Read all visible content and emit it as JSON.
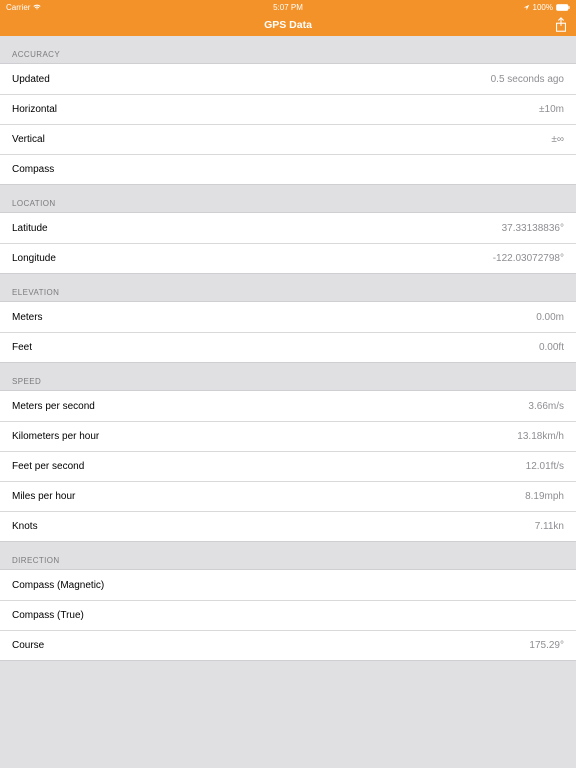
{
  "status": {
    "carrier": "Carrier",
    "time": "5:07 PM",
    "battery": "100%"
  },
  "nav": {
    "title": "GPS Data"
  },
  "sections": {
    "accuracy": {
      "header": "ACCURACY",
      "rows": {
        "updated": {
          "label": "Updated",
          "value": "0.5 seconds ago"
        },
        "horizontal": {
          "label": "Horizontal",
          "value": "±10m"
        },
        "vertical": {
          "label": "Vertical",
          "value": "±∞"
        },
        "compass": {
          "label": "Compass",
          "value": ""
        }
      }
    },
    "location": {
      "header": "LOCATION",
      "rows": {
        "latitude": {
          "label": "Latitude",
          "value": "37.33138836°"
        },
        "longitude": {
          "label": "Longitude",
          "value": "-122.03072798°"
        }
      }
    },
    "elevation": {
      "header": "ELEVATION",
      "rows": {
        "meters": {
          "label": "Meters",
          "value": "0.00m"
        },
        "feet": {
          "label": "Feet",
          "value": "0.00ft"
        }
      }
    },
    "speed": {
      "header": "SPEED",
      "rows": {
        "mps": {
          "label": "Meters per second",
          "value": "3.66m/s"
        },
        "kmh": {
          "label": "Kilometers per hour",
          "value": "13.18km/h"
        },
        "fps": {
          "label": "Feet per second",
          "value": "12.01ft/s"
        },
        "mph": {
          "label": "Miles per hour",
          "value": "8.19mph"
        },
        "kn": {
          "label": "Knots",
          "value": "7.11kn"
        }
      }
    },
    "direction": {
      "header": "DIRECTION",
      "rows": {
        "compass_mag": {
          "label": "Compass (Magnetic)",
          "value": ""
        },
        "compass_true": {
          "label": "Compass (True)",
          "value": ""
        },
        "course": {
          "label": "Course",
          "value": "175.29°"
        }
      }
    }
  }
}
